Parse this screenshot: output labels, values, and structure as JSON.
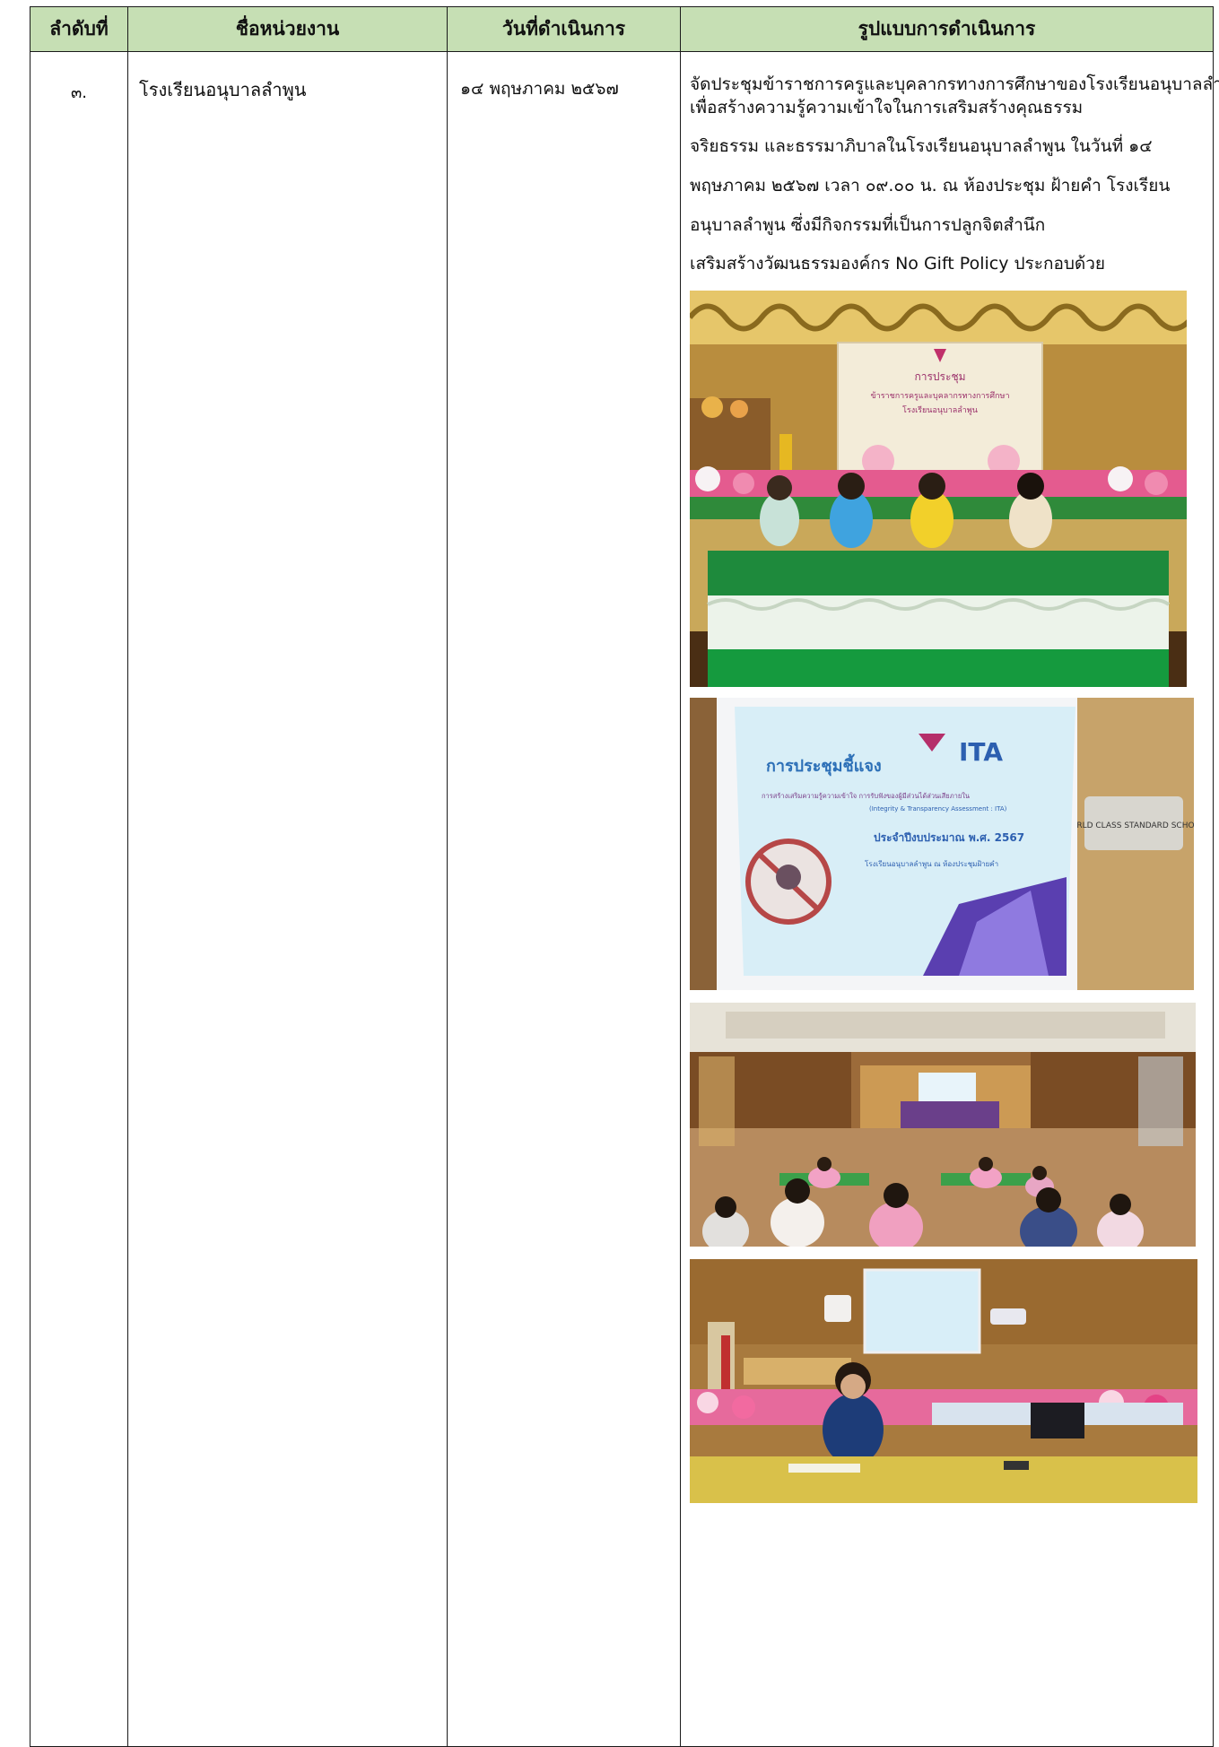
{
  "headers": {
    "no": "ลำดับที่",
    "unit": "ชื่อหน่วยงาน",
    "date": "วันที่ดำเนินการ",
    "format": "รูปแบบการดำเนินการ"
  },
  "row": {
    "no": "๓.",
    "unit": "โรงเรียนอนุบาลลำพูน",
    "date": "๑๔  พฤษภาคม ๒๕๖๗",
    "description_lines": [
      "จัดประชุมข้าราชการครูและบุคลากรทางการศึกษาของโรงเรียนอนุบาลลำพูน",
      "เพื่อสร้างความรู้ความเข้าใจในการเสริมสร้างคุณธรรม",
      "จริยธรรม และธรรมาภิบาลในโรงเรียนอนุบาลลำพูน ในวันที่ ๑๔",
      "พฤษภาคม  ๒๕๖๗ เวลา ๐๙.๐๐ น. ณ ห้องประชุม ฝ้ายคำ โรงเรียน",
      "อนุบาลลำพูน  ซึ่งมีกิจกรรมที่เป็นการปลูกจิตสำนึก",
      "เสริมสร้างวัฒนธรรมองค์กร No Gift Policy ประกอบด้วย"
    ]
  },
  "photos": {
    "p1": {
      "screen_title": "การประชุม",
      "screen_line1": "ข้าราชการครูและบุคลากรทางการศึกษา",
      "screen_line2": "โรงเรียนอนุบาลลำพูน"
    },
    "p2": {
      "title": "การประชุมชี้แจง",
      "ita": "ITA",
      "sub1": "การสร้างเสริมความรู้ความเข้าใจ การรับฟังของผู้มีส่วนได้ส่วนเสียภายใน",
      "sub2": "(Integrity & Transparency Assessment : ITA)",
      "year": "ประจำปีงบประมาณ พ.ศ. 2567",
      "venue": "โรงเรียนอนุบาลลำพูน ณ ห้องประชุมฝ้ายคำ",
      "logo_text": "WORLD CLASS STANDARD SCHOOL"
    }
  },
  "colors": {
    "header_bg": "#c6dfb4",
    "border": "#1a1a1a"
  }
}
